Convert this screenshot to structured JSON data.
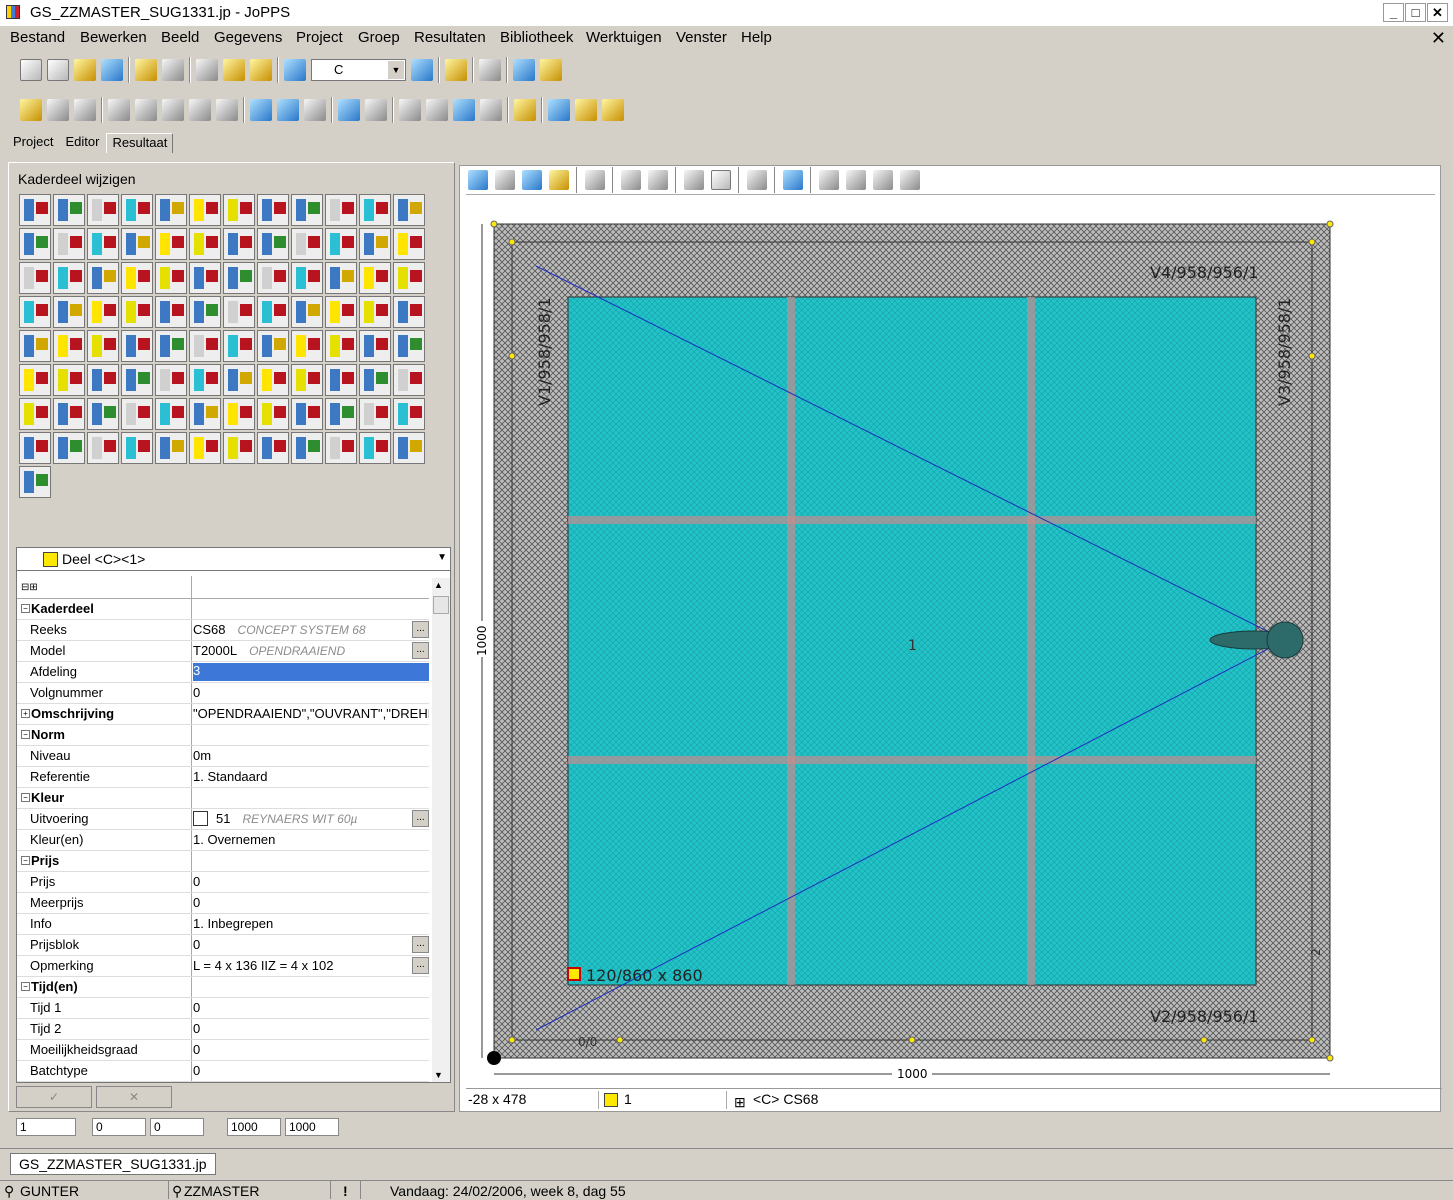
{
  "window": {
    "title": "GS_ZZMASTER_SUG1331.jp - JoPPS",
    "min": "_",
    "max": "□",
    "close": "✕"
  },
  "menu": {
    "items": [
      "Bestand",
      "Bewerken",
      "Beeld",
      "Gegevens",
      "Project",
      "Groep",
      "Resultaten",
      "Bibliotheek",
      "Werktuigen",
      "Venster",
      "Help"
    ],
    "close": "✕"
  },
  "toolbar": {
    "combo_value": "C"
  },
  "tabs": [
    "Project",
    "Editor",
    "Resultaat"
  ],
  "editor": {
    "panel_title": "Kaderdeel wijzigen",
    "selector_label": "Deel <C><1>",
    "tree_toggle": "⊟⊞",
    "props": [
      {
        "key": "Kaderdeel",
        "section": true,
        "expand": "−"
      },
      {
        "key": "Reeks",
        "value": "CS68",
        "note": "CONCEPT SYSTEM 68",
        "dots": "..."
      },
      {
        "key": "Model",
        "value": "T2000L",
        "note": "OPENDRAAIEND",
        "dots": "..."
      },
      {
        "key": "Afdeling",
        "value": "3",
        "highlight": true
      },
      {
        "key": "Volgnummer",
        "value": "0"
      },
      {
        "key": "Omschrijving",
        "section": true,
        "expand": "+",
        "value": "\"OPENDRAAIEND\",\"OUVRANT\",\"DREHFLÜGEL\""
      },
      {
        "key": "Norm",
        "section": true,
        "expand": "−"
      },
      {
        "key": "Niveau",
        "value": "0m"
      },
      {
        "key": "Referentie",
        "value": "1. Standaard"
      },
      {
        "key": "Kleur",
        "section": true,
        "expand": "−"
      },
      {
        "key": "Uitvoering",
        "value": "51",
        "note": "REYNAERS WIT 60µ",
        "dots": "...",
        "swatch": true
      },
      {
        "key": "Kleur(en)",
        "value": "1. Overnemen"
      },
      {
        "key": "Prijs",
        "section": true,
        "expand": "−"
      },
      {
        "key": "Prijs",
        "value": "0"
      },
      {
        "key": "Meerprijs",
        "value": "0"
      },
      {
        "key": "Info",
        "value": "1. Inbegrepen"
      },
      {
        "key": "Prijsblok",
        "value": "0",
        "dots": "..."
      },
      {
        "key": "Opmerking",
        "value": "L = 4 x 136  IIZ = 4 x 102",
        "dots": "..."
      },
      {
        "key": "Tijd(en)",
        "section": true,
        "expand": "−"
      },
      {
        "key": "Tijd 1",
        "value": "0"
      },
      {
        "key": "Tijd 2",
        "value": "0"
      },
      {
        "key": "Moeilijkheidsgraad",
        "value": "0"
      },
      {
        "key": "Batchtype",
        "value": "0"
      }
    ],
    "ok_label": "✓",
    "cancel_label": "✕",
    "fields": [
      "1",
      "0",
      "0",
      "1000",
      "1000"
    ]
  },
  "drawing": {
    "labels": {
      "top": "V4/958/956/1",
      "right": "V3/958/958/1",
      "left": "V1/958/958/1",
      "bottom": "V2/958/956/1",
      "glass": "120/860 x 860",
      "center": "1",
      "small_bottom": "0/0",
      "small_right": "2"
    },
    "dim_width": "1000",
    "dim_height": "1000",
    "colors": {
      "glass": "#21c4c9",
      "frame": "#bdbdbd",
      "grid": "#c48d8d"
    }
  },
  "canvas_status": {
    "coords": "-28 x 478",
    "part": "1",
    "system": "<C> CS68"
  },
  "doc_tab": "GS_ZZMASTER_SUG1331.jp",
  "status": {
    "user": "GUNTER",
    "db": "ZZMASTER",
    "alert": "!",
    "date": "Vandaag: 24/02/2006, week 8, dag 55"
  }
}
